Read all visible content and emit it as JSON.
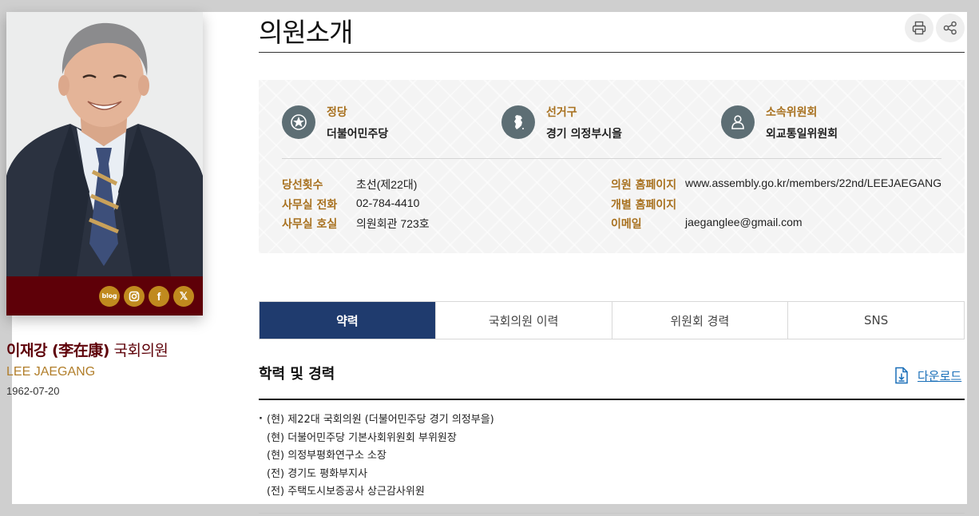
{
  "profile": {
    "name_main": "이재강 (李在康)",
    "name_suffix": "국회의원",
    "name_english": "LEE JAEGANG",
    "birth_date": "1962-07-20",
    "social": {
      "blog_label": "blog"
    }
  },
  "page": {
    "title": "의원소개"
  },
  "info": {
    "party": {
      "label": "정당",
      "value": "더불어민주당"
    },
    "district": {
      "label": "선거구",
      "value": "경기 의정부시을"
    },
    "committee": {
      "label": "소속위원회",
      "value": "외교통일위원회"
    },
    "details_left": [
      {
        "key": "당선횟수",
        "value": "초선(제22대)"
      },
      {
        "key": "사무실 전화",
        "value": "02-784-4410"
      },
      {
        "key": "사무실 호실",
        "value": "의원회관 723호"
      }
    ],
    "details_right": [
      {
        "key": "의원 홈페이지",
        "value": "www.assembly.go.kr/members/22nd/LEEJAEGANG"
      },
      {
        "key": "개별 홈페이지",
        "value": ""
      },
      {
        "key": "이메일",
        "value": "jaeganglee@gmail.com"
      }
    ]
  },
  "tabs": [
    "약력",
    "국회의원 이력",
    "위원회 경력",
    "SNS"
  ],
  "section": {
    "title": "학력 및 경력",
    "download_label": "다운로드",
    "career": [
      "(현) 제22대 국회의원 (더불어민주당 경기 의정부을)",
      "(현) 더불어민주당 기본사회위원회 부위원장",
      "(현) 의정부평화연구소 소장",
      "(전) 경기도 평화부지사",
      "(전) 주택도시보증공사 상근감사위원"
    ]
  },
  "colors": {
    "maroon": "#5e0008",
    "gold": "#a8711f",
    "navy_tab": "#1f3b6e",
    "link_blue": "#1a6fb8"
  }
}
